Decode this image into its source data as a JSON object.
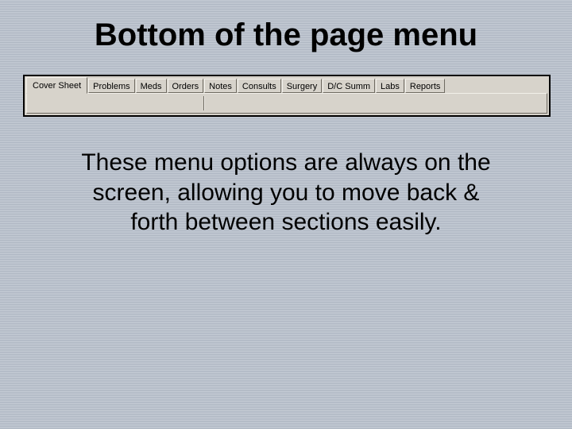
{
  "title": "Bottom of the page menu",
  "tabs": [
    {
      "label": "Cover Sheet",
      "active": true
    },
    {
      "label": "Problems",
      "active": false
    },
    {
      "label": "Meds",
      "active": false
    },
    {
      "label": "Orders",
      "active": false
    },
    {
      "label": "Notes",
      "active": false
    },
    {
      "label": "Consults",
      "active": false
    },
    {
      "label": "Surgery",
      "active": false
    },
    {
      "label": "D/C Summ",
      "active": false
    },
    {
      "label": "Labs",
      "active": false
    },
    {
      "label": "Reports",
      "active": false
    }
  ],
  "description": "These menu options are always on the screen, allowing you to move back & forth between sections easily."
}
